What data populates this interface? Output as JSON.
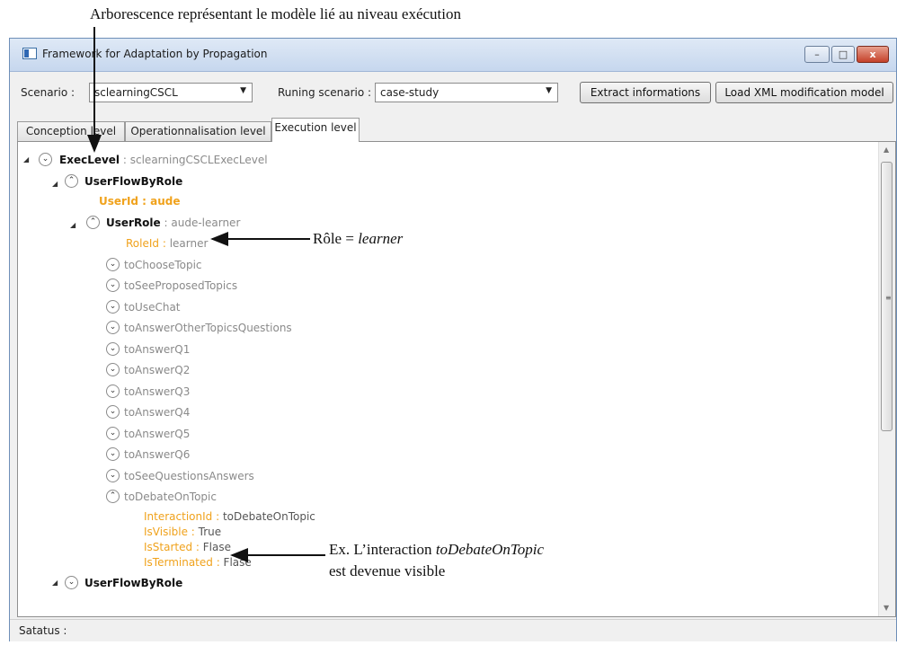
{
  "annotations": {
    "top": "Arborescence représentant le modèle lié au niveau exécution",
    "role_prefix": "Rôle = ",
    "role_value": "learner",
    "interaction_prefix": "Ex. L’interaction ",
    "interaction_value": "toDebateOnTopic",
    "interaction_line2": "est devenue visible"
  },
  "window": {
    "title": "Framework for Adaptation by Propagation",
    "minimize_glyph": "–",
    "maximize_glyph": "□",
    "close_glyph": "x"
  },
  "toolbar": {
    "scenario_label": "Scenario :",
    "scenario_value": "sclearningCSCL",
    "running_label": "Runing scenario :",
    "running_value": "case-study",
    "extract_button": "Extract informations",
    "load_button": "Load XML modification model",
    "dropdown_glyph": "▼"
  },
  "tabs": [
    "Conception level",
    "Operationnalisation level",
    "Execution level"
  ],
  "tree": {
    "root_key": "ExecLevel",
    "root_value": ": sclearningCSCLExecLevel",
    "userflow_label": "UserFlowByRole",
    "userid_label": "UserId : aude",
    "userrole_key": "UserRole",
    "userrole_value": ": aude-learner",
    "roleid_key": "RoleId :",
    "roleid_value": " learner",
    "interactions": [
      "toChooseTopic",
      "toSeeProposedTopics",
      "toUseChat",
      "toAnswerOtherTopicsQuestions",
      "toAnswerQ1",
      "toAnswerQ2",
      "toAnswerQ3",
      "toAnswerQ4",
      "toAnswerQ5",
      "toAnswerQ6",
      "toSeeQuestionsAnswers"
    ],
    "debate_label": "toDebateOnTopic",
    "properties": [
      {
        "key": "InteractionId :",
        "value": " toDebateOnTopic"
      },
      {
        "key": "IsVisible :",
        "value": " True"
      },
      {
        "key": "IsStarted :",
        "value": " Flase"
      },
      {
        "key": "IsTerminated :",
        "value": " Flase"
      }
    ],
    "userflow2_label": "UserFlowByRole",
    "expand_glyph": "⌄",
    "collapse_glyph": "⌃",
    "expanded_triangle": "◢",
    "scroll_grip": "≡"
  },
  "status": {
    "label": "Satatus :"
  }
}
